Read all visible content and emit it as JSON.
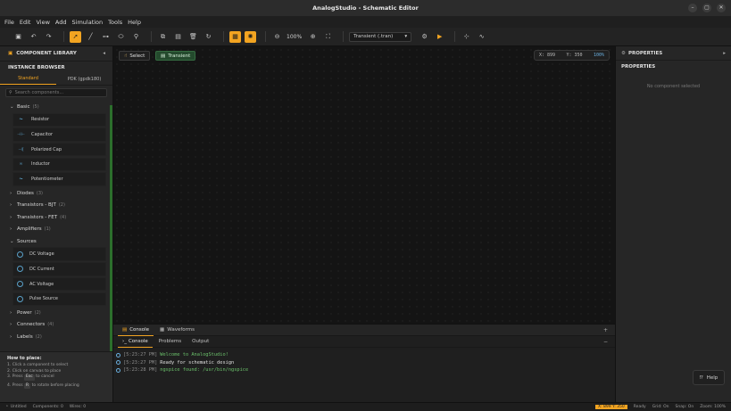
{
  "window": {
    "title": "AnalogStudio - Schematic Editor",
    "controls": [
      "–",
      "▢",
      "✕"
    ]
  },
  "menu": [
    "File",
    "Edit",
    "View",
    "Add",
    "Simulation",
    "Tools",
    "Help"
  ],
  "toolbar": {
    "zoom": "100%",
    "analysis": "Transient (.tran)"
  },
  "left_panel": {
    "library_title": "COMPONENT LIBRARY",
    "instance_browser": "INSTANCE BROWSER",
    "tabs": [
      "Standard",
      "PDK (gpdk180)"
    ],
    "search_placeholder": "Search components...",
    "categories": [
      {
        "label": "Basic",
        "count": "(5)",
        "expanded": true,
        "items": [
          "Resistor",
          "Capacitor",
          "Polarized Cap",
          "Inductor",
          "Potentiometer"
        ]
      },
      {
        "label": "Diodes",
        "count": "(3)",
        "expanded": false,
        "items": []
      },
      {
        "label": "Transistors - BJT",
        "count": "(2)",
        "expanded": false,
        "items": []
      },
      {
        "label": "Transistors - FET",
        "count": "(4)",
        "expanded": false,
        "items": []
      },
      {
        "label": "Amplifiers",
        "count": "(1)",
        "expanded": false,
        "items": []
      },
      {
        "label": "Sources",
        "count": "",
        "expanded": true,
        "items": [
          "DC Voltage",
          "DC Current",
          "AC Voltage",
          "Pulse Source"
        ]
      },
      {
        "label": "Power",
        "count": "(2)",
        "expanded": false,
        "items": []
      },
      {
        "label": "Connectors",
        "count": "(4)",
        "expanded": false,
        "items": []
      },
      {
        "label": "Labels",
        "count": "(2)",
        "expanded": false,
        "items": []
      }
    ],
    "howto": {
      "title": "How to place:",
      "line1": "1. Click a component to select",
      "line2": "2. Click on canvas to place",
      "line3_pre": "3. Press",
      "line3_key": "Esc",
      "line3_post": "to cancel",
      "line4_pre": "4. Press",
      "line4_key": "R",
      "line4_post": "to rotate before placing"
    }
  },
  "canvas": {
    "select_label": "Select",
    "transient_label": "Transient",
    "coord_x": "X: 899",
    "coord_y": "Y: 350",
    "zoom": "100%"
  },
  "bottom_panel": {
    "tabs": [
      "Console",
      "Waveforms"
    ],
    "console_tabs": [
      "Console",
      "Problems",
      "Output"
    ],
    "logs": [
      {
        "ts": "[5:23:27 PM]",
        "msg": "Welcome to AnalogStudio!",
        "color": "green"
      },
      {
        "ts": "[5:23:27 PM]",
        "msg": "Ready for schematic design",
        "color": "white"
      },
      {
        "ts": "[5:23:28 PM]",
        "msg": "ngspice found: /usr/bin/ngspice",
        "color": "green"
      }
    ]
  },
  "right_panel": {
    "header": "PROPERTIES",
    "subheader": "PROPERTIES",
    "empty": "No component selected",
    "help": "Help"
  },
  "status_bar": {
    "file": "Untitled",
    "components": "Components: 0",
    "wires": "Wires: 0",
    "coords": "X: 899 Y: 350",
    "ready": "Ready",
    "grid": "Grid: On",
    "snap": "Snap: On",
    "zoom": "Zoom: 100%"
  },
  "colors": {
    "accent": "#f2a421",
    "transient_bg": "#244a2d",
    "log_green": "#6cc36c",
    "info_blue": "#6ab0e0"
  }
}
